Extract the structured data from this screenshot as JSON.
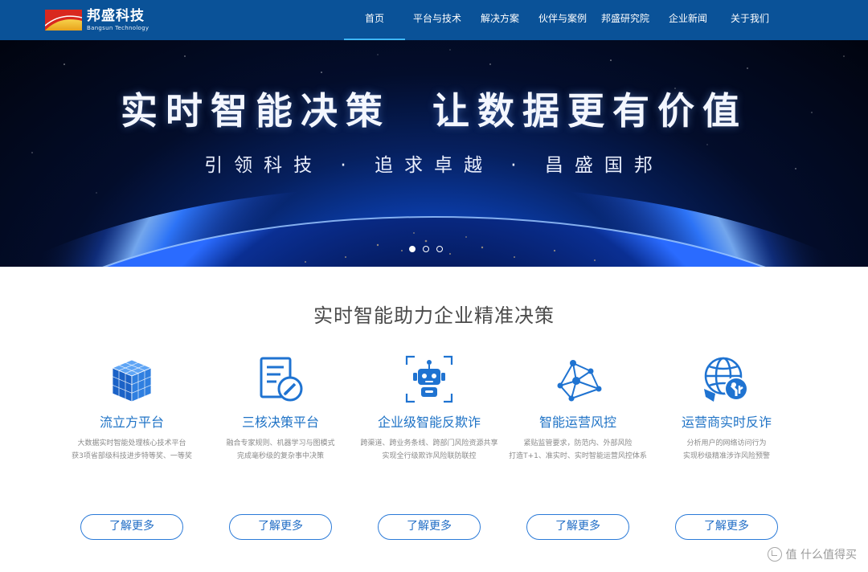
{
  "header": {
    "logo_cn": "邦盛科技",
    "logo_en": "Bangsun Technology",
    "nav": [
      {
        "label": "首页",
        "active": true
      },
      {
        "label": "平台与技术"
      },
      {
        "label": "解决方案"
      },
      {
        "label": "伙伴与案例"
      },
      {
        "label": "邦盛研究院"
      },
      {
        "label": "企业新闻"
      },
      {
        "label": "关于我们"
      }
    ]
  },
  "banner": {
    "title": "实时智能决策  让数据更有价值",
    "subtitle": "引领科技 · 追求卓越 · 昌盛国邦",
    "slides": 3,
    "active_slide": 1
  },
  "section": {
    "title": "实时智能助力企业精准决策",
    "cards": [
      {
        "icon": "cube-stack-icon",
        "title": "流立方平台",
        "desc": [
          "大数据实时智能处理核心技术平台",
          "获3项省部级科技进步特等奖、一等奖"
        ],
        "button": "了解更多"
      },
      {
        "icon": "document-edit-icon",
        "title": "三核决策平台",
        "desc": [
          "融合专家规则、机器学习与图模式",
          "完成毫秒级的复杂事中决策"
        ],
        "button": "了解更多"
      },
      {
        "icon": "robot-icon",
        "title": "企业级智能反欺诈",
        "desc": [
          "跨渠道、跨业务条线、跨部门风险资源共享",
          "实现全行级欺诈风险联防联控"
        ],
        "button": "了解更多"
      },
      {
        "icon": "network-nodes-icon",
        "title": "智能运营风控",
        "desc": [
          "紧贴监管要求，防范内、外部风险",
          "打造T+1、准实时、实时智能运营风控体系"
        ],
        "button": "了解更多"
      },
      {
        "icon": "globe-shield-icon",
        "title": "运营商实时反诈",
        "desc": [
          "分析用户的网络访问行为",
          "实现秒级精准涉诈风险预警"
        ],
        "button": "了解更多"
      }
    ]
  },
  "watermark": "值 什么值得买",
  "colors": {
    "header": "#0a5298",
    "accent": "#1f73c6",
    "nav_underline": "#3fb8ff"
  }
}
